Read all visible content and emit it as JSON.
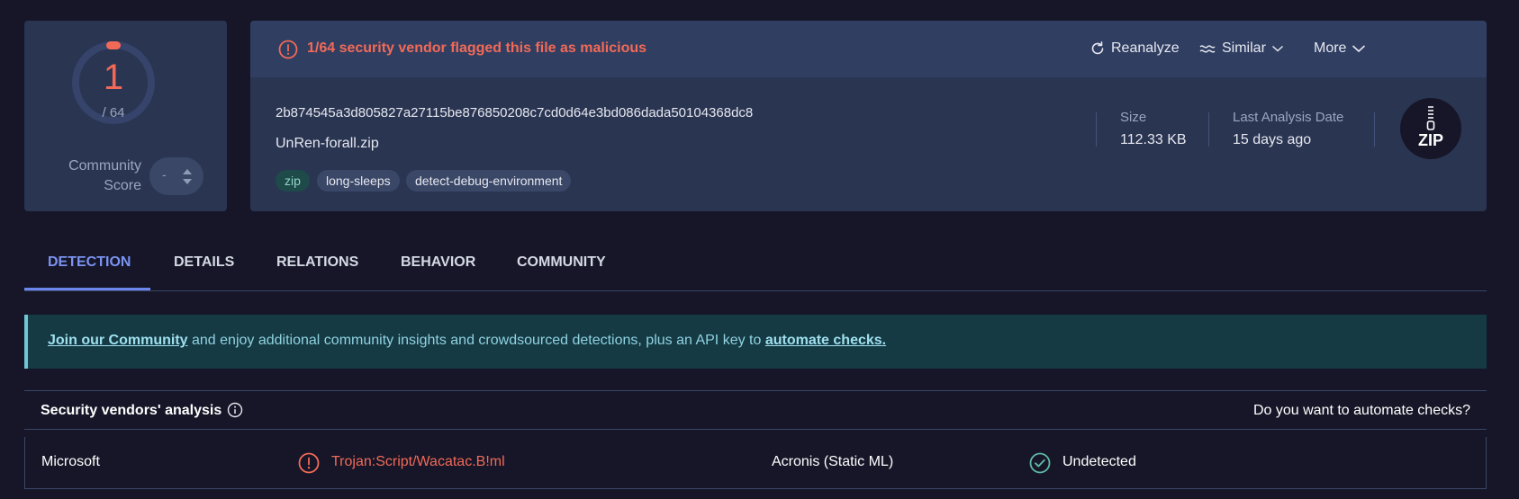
{
  "score": {
    "detections": "1",
    "total": "/ 64",
    "community_label_line1": "Community",
    "community_label_line2": "Score",
    "community_value": "-",
    "accent": "#f26a57"
  },
  "alert": {
    "text": "1/64 security vendor flagged this file as malicious"
  },
  "actions": {
    "reanalyze": "Reanalyze",
    "similar": "Similar",
    "more": "More"
  },
  "file": {
    "hash": "2b874545a3d805827a27115be876850208c7cd0d64e3bd086dada50104368dc8",
    "name": "UnRen-forall.zip",
    "tags": [
      "zip",
      "long-sleeps",
      "detect-debug-environment"
    ],
    "size_label": "Size",
    "size_value": "112.33 KB",
    "date_label": "Last Analysis Date",
    "date_value": "15 days ago",
    "type_badge": "ZIP"
  },
  "tabs": [
    "DETECTION",
    "DETAILS",
    "RELATIONS",
    "BEHAVIOR",
    "COMMUNITY"
  ],
  "banner": {
    "link1": "Join our Community",
    "middle": " and enjoy additional community insights and crowdsourced detections, plus an API key to ",
    "link2": "automate checks."
  },
  "vendors": {
    "title": "Security vendors' analysis",
    "automate": "Do you want to automate checks?",
    "rows": [
      {
        "vendor1": "Microsoft",
        "result1": "Trojan:Script/Wacatac.B!ml",
        "vendor2": "Acronis (Static ML)",
        "result2": "Undetected"
      }
    ]
  },
  "colors": {
    "malicious": "#f26a57",
    "undetected": "#5fb8a5",
    "tab_active": "#7b93f0"
  }
}
